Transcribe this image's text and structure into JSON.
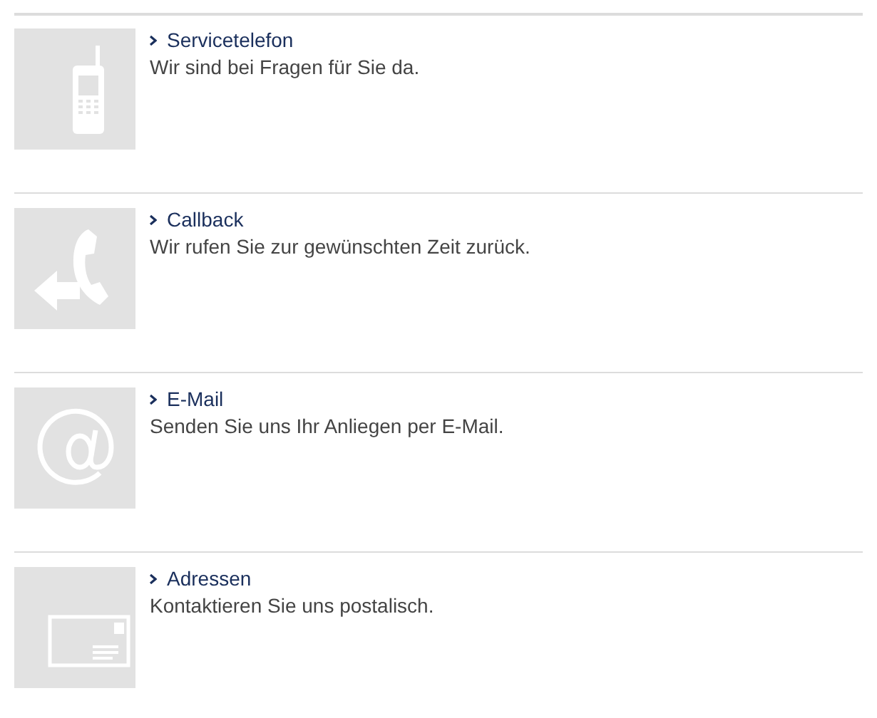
{
  "contact_options": [
    {
      "kind": "phone",
      "title": "Servicetelefon",
      "description": "Wir sind bei Fragen für Sie da."
    },
    {
      "kind": "callback",
      "title": "Callback",
      "description": "Wir rufen Sie zur gewünschten Zeit zurück."
    },
    {
      "kind": "email",
      "title": "E-Mail",
      "description": "Senden Sie uns Ihr Anliegen per E-Mail."
    },
    {
      "kind": "letter",
      "title": "Adressen",
      "description": "Kontaktieren Sie uns postalisch."
    }
  ]
}
